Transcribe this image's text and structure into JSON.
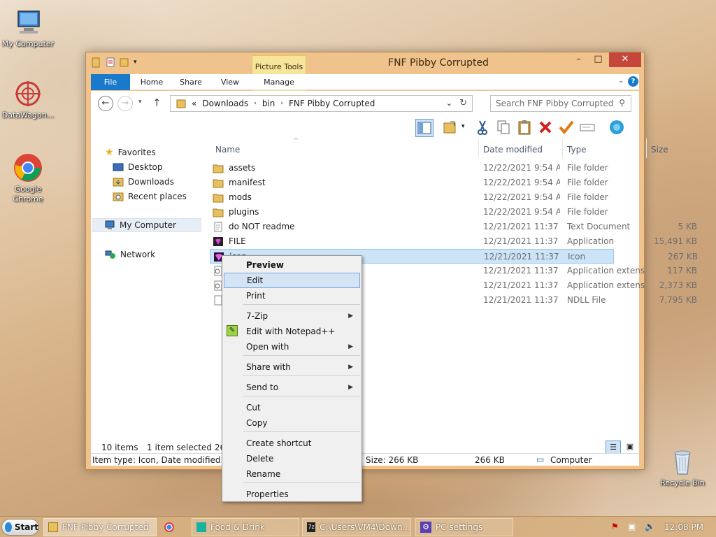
{
  "desktop": {
    "icons": [
      {
        "label": "My Computer"
      },
      {
        "label": "DataWagon..."
      },
      {
        "label": "Google Chrome"
      },
      {
        "label": "Recycle Bin"
      }
    ]
  },
  "window": {
    "title": "FNF Pibby Corrupted",
    "context_tab_group": "Picture Tools",
    "tabs": [
      "File",
      "Home",
      "Share",
      "View",
      "Manage"
    ],
    "address": {
      "prefix": "«",
      "crumbs": [
        "Downloads",
        "bin",
        "FNF Pibby Corrupted"
      ]
    },
    "search_placeholder": "Search FNF Pibby Corrupted"
  },
  "nav": {
    "favorites": "Favorites",
    "items": [
      "Desktop",
      "Downloads",
      "Recent places"
    ],
    "computer": "My Computer",
    "network": "Network"
  },
  "columns": [
    "Name",
    "Date modified",
    "Type",
    "Size"
  ],
  "files": [
    {
      "name": "assets",
      "date": "12/22/2021 9:54 AM",
      "type": "File folder",
      "size": "",
      "icon": "folder-icon"
    },
    {
      "name": "manifest",
      "date": "12/22/2021 9:54 AM",
      "type": "File folder",
      "size": "",
      "icon": "folder-icon"
    },
    {
      "name": "mods",
      "date": "12/22/2021 9:54 AM",
      "type": "File folder",
      "size": "",
      "icon": "folder-icon"
    },
    {
      "name": "plugins",
      "date": "12/22/2021 9:54 AM",
      "type": "File folder",
      "size": "",
      "icon": "folder-icon"
    },
    {
      "name": "do NOT readme",
      "date": "12/21/2021 11:37 ...",
      "type": "Text Document",
      "size": "5 KB",
      "icon": "text-file-icon"
    },
    {
      "name": "FILE",
      "date": "12/21/2021 11:37 ...",
      "type": "Application",
      "size": "15,491 KB",
      "icon": "app-icon"
    },
    {
      "name": "icon",
      "date": "12/21/2021 11:37 ...",
      "type": "Icon",
      "size": "267 KB",
      "icon": "image-icon"
    },
    {
      "name": "",
      "date": "12/21/2021 11:37 ...",
      "type": "Application extens...",
      "size": "117 KB",
      "icon": "dll-icon"
    },
    {
      "name": "",
      "date": "12/21/2021 11:37 ...",
      "type": "Application extens...",
      "size": "2,373 KB",
      "icon": "dll-icon"
    },
    {
      "name": "",
      "date": "12/21/2021 11:37 ...",
      "type": "NDLL File",
      "size": "7,795 KB",
      "icon": "blank-file-icon"
    }
  ],
  "status": {
    "count": "10 items",
    "selected": "1 item selected  266 KB",
    "details_left": "Item type: Icon, Date modified: 12/2",
    "details_size": "Size: 266 KB",
    "details_size2": "266 KB",
    "details_location": "Computer"
  },
  "context_menu": {
    "items": [
      {
        "label": "Preview",
        "bold": true,
        "submenu": false
      },
      {
        "label": "Edit",
        "submenu": false
      },
      {
        "label": "Print",
        "submenu": false
      },
      {
        "label": "7-Zip",
        "submenu": true
      },
      {
        "label": "Edit with Notepad++",
        "submenu": false
      },
      {
        "label": "Open with",
        "submenu": true
      },
      {
        "label": "Share with",
        "submenu": true
      },
      {
        "label": "Send to",
        "submenu": true
      },
      {
        "label": "Cut",
        "submenu": false
      },
      {
        "label": "Copy",
        "submenu": false
      },
      {
        "label": "Create shortcut",
        "submenu": false
      },
      {
        "label": "Delete",
        "submenu": false
      },
      {
        "label": "Rename",
        "submenu": false
      },
      {
        "label": "Properties",
        "submenu": false
      }
    ]
  },
  "taskbar": {
    "start": "Start",
    "buttons": [
      "FNF Pibby Corrupted",
      "Food & Drink",
      "C:\\Users\\VM4\\Down...",
      "PC settings"
    ],
    "clock": "12:08 PM"
  },
  "colors": {
    "accent": "#1979ca",
    "selection": "#cce4f7",
    "close": "#c7463c",
    "picture_tools": "#f7e59a"
  }
}
